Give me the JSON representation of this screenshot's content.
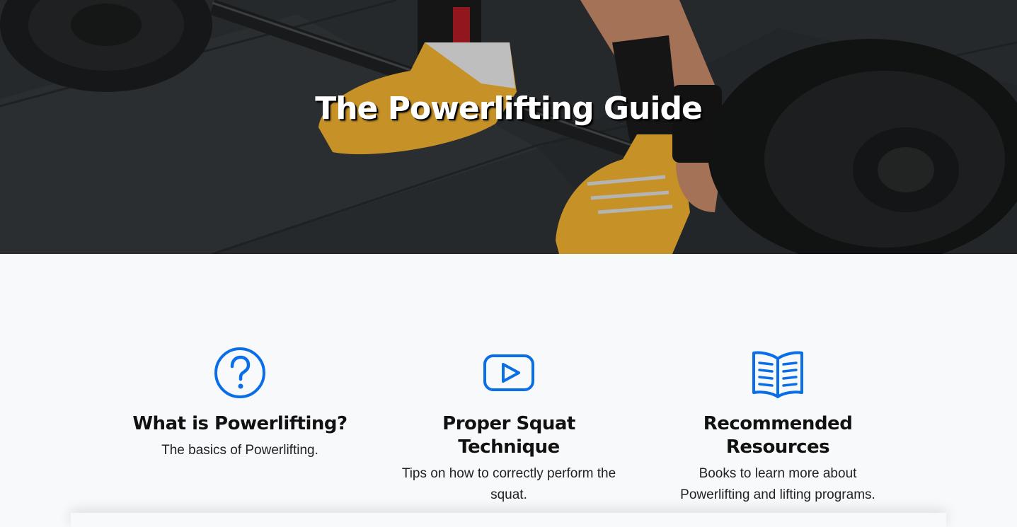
{
  "hero": {
    "title": "The Powerlifting Guide",
    "image": "barbell-deadlift-photo"
  },
  "features": [
    {
      "icon": "question-circle-icon",
      "title": "What is Powerlifting?",
      "description": "The basics of Powerlifting."
    },
    {
      "icon": "play-video-icon",
      "title": "Proper Squat Technique",
      "description": "Tips on how to correctly perform the squat."
    },
    {
      "icon": "open-book-icon",
      "title": "Recommended Resources",
      "description": "Books to learn more about Powerlifting and lifting programs."
    }
  ],
  "colors": {
    "accent": "#0a6ee8",
    "background": "#f7f9fb",
    "shoe": "#f2b230",
    "floor": "#2e3234"
  }
}
